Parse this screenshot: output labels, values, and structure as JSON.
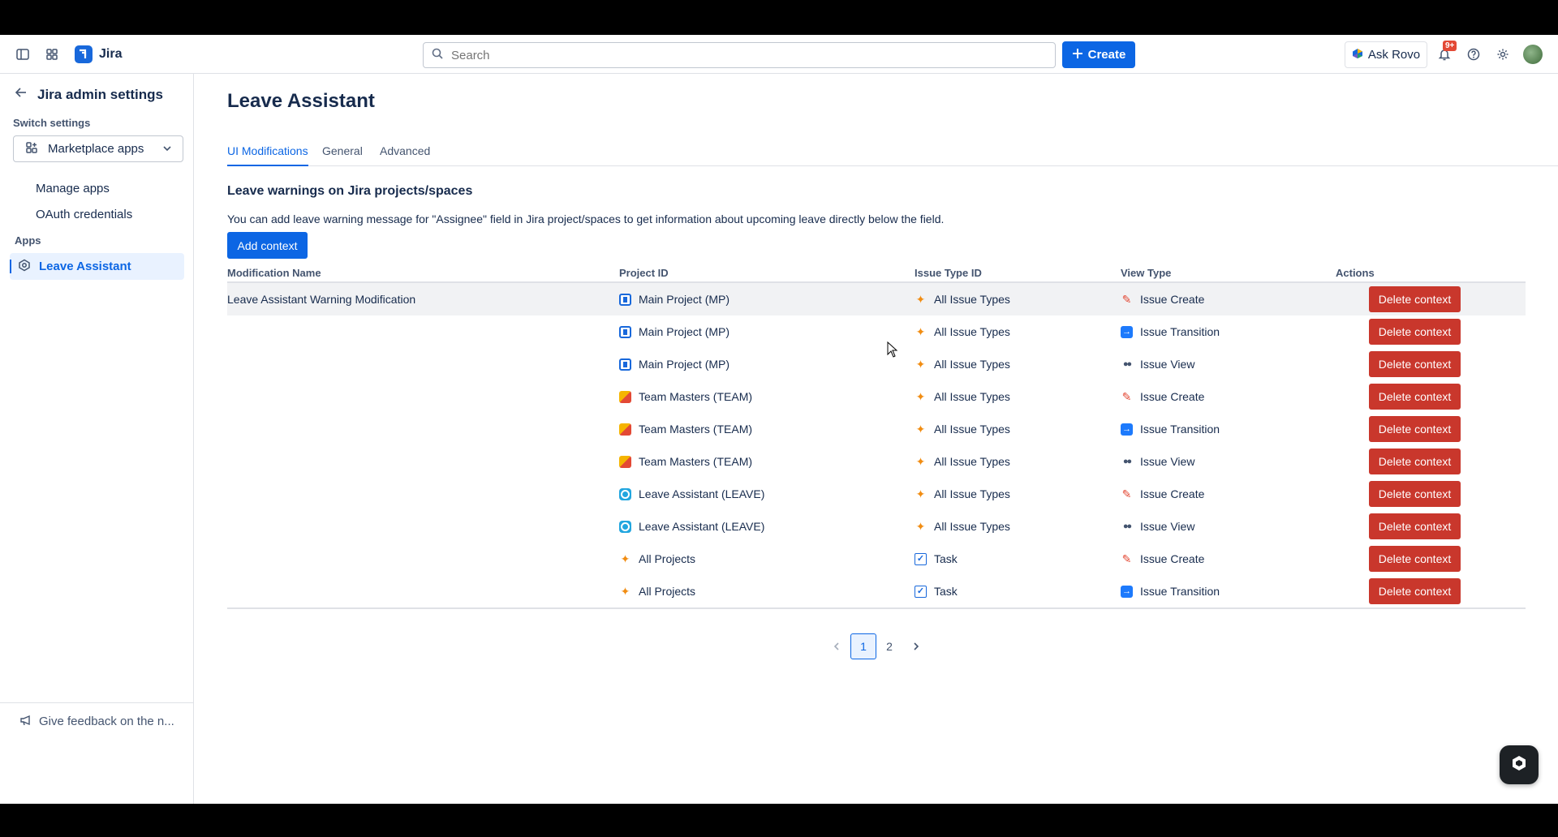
{
  "topnav": {
    "app_name": "Jira",
    "search_placeholder": "Search",
    "create_label": "Create",
    "ask_rovo_label": "Ask Rovo",
    "notifications_badge": "9+"
  },
  "sidebar": {
    "back_title": "Jira admin settings",
    "switch_label": "Switch settings",
    "switch_value": "Marketplace apps",
    "links": [
      "Manage apps",
      "OAuth credentials"
    ],
    "apps_label": "Apps",
    "active_item": "Leave Assistant",
    "feedback": "Give feedback on the n..."
  },
  "main": {
    "title": "Leave Assistant",
    "tabs": [
      "UI Modifications",
      "General",
      "Advanced"
    ],
    "active_tab": "UI Modifications",
    "section_title": "Leave warnings on Jira projects/spaces",
    "section_desc": "You can add leave warning message for \"Assignee\" field in Jira project/spaces to get information about upcoming leave directly below the field.",
    "add_button": "Add context"
  },
  "table": {
    "columns": [
      "Modification Name",
      "Project ID",
      "Issue Type ID",
      "View Type",
      "Actions"
    ],
    "delete_label": "Delete context",
    "rows": [
      {
        "name": "Leave Assistant Warning Modification",
        "project": "Main Project (MP)",
        "project_icon": "mp",
        "issue_type": "All Issue Types",
        "issue_icon": "spark",
        "view": "Issue Create",
        "view_icon": "pencil"
      },
      {
        "name": "",
        "project": "Main Project (MP)",
        "project_icon": "mp",
        "issue_type": "All Issue Types",
        "issue_icon": "spark",
        "view": "Issue Transition",
        "view_icon": "arrow"
      },
      {
        "name": "",
        "project": "Main Project (MP)",
        "project_icon": "mp",
        "issue_type": "All Issue Types",
        "issue_icon": "spark",
        "view": "Issue View",
        "view_icon": "eyes"
      },
      {
        "name": "",
        "project": "Team Masters (TEAM)",
        "project_icon": "team",
        "issue_type": "All Issue Types",
        "issue_icon": "spark",
        "view": "Issue Create",
        "view_icon": "pencil"
      },
      {
        "name": "",
        "project": "Team Masters (TEAM)",
        "project_icon": "team",
        "issue_type": "All Issue Types",
        "issue_icon": "spark",
        "view": "Issue Transition",
        "view_icon": "arrow"
      },
      {
        "name": "",
        "project": "Team Masters (TEAM)",
        "project_icon": "team",
        "issue_type": "All Issue Types",
        "issue_icon": "spark",
        "view": "Issue View",
        "view_icon": "eyes"
      },
      {
        "name": "",
        "project": "Leave Assistant (LEAVE)",
        "project_icon": "leave",
        "issue_type": "All Issue Types",
        "issue_icon": "spark",
        "view": "Issue Create",
        "view_icon": "pencil"
      },
      {
        "name": "",
        "project": "Leave Assistant (LEAVE)",
        "project_icon": "leave",
        "issue_type": "All Issue Types",
        "issue_icon": "spark",
        "view": "Issue View",
        "view_icon": "eyes"
      },
      {
        "name": "",
        "project": "All Projects",
        "project_icon": "spark",
        "issue_type": "Task",
        "issue_icon": "task",
        "view": "Issue Create",
        "view_icon": "pencil"
      },
      {
        "name": "",
        "project": "All Projects",
        "project_icon": "spark",
        "issue_type": "Task",
        "issue_icon": "task",
        "view": "Issue Transition",
        "view_icon": "arrow"
      }
    ]
  },
  "pagination": {
    "pages": [
      "1",
      "2"
    ],
    "current": "1"
  },
  "colors": {
    "brand": "#0c66e4",
    "danger": "#c9372c"
  }
}
